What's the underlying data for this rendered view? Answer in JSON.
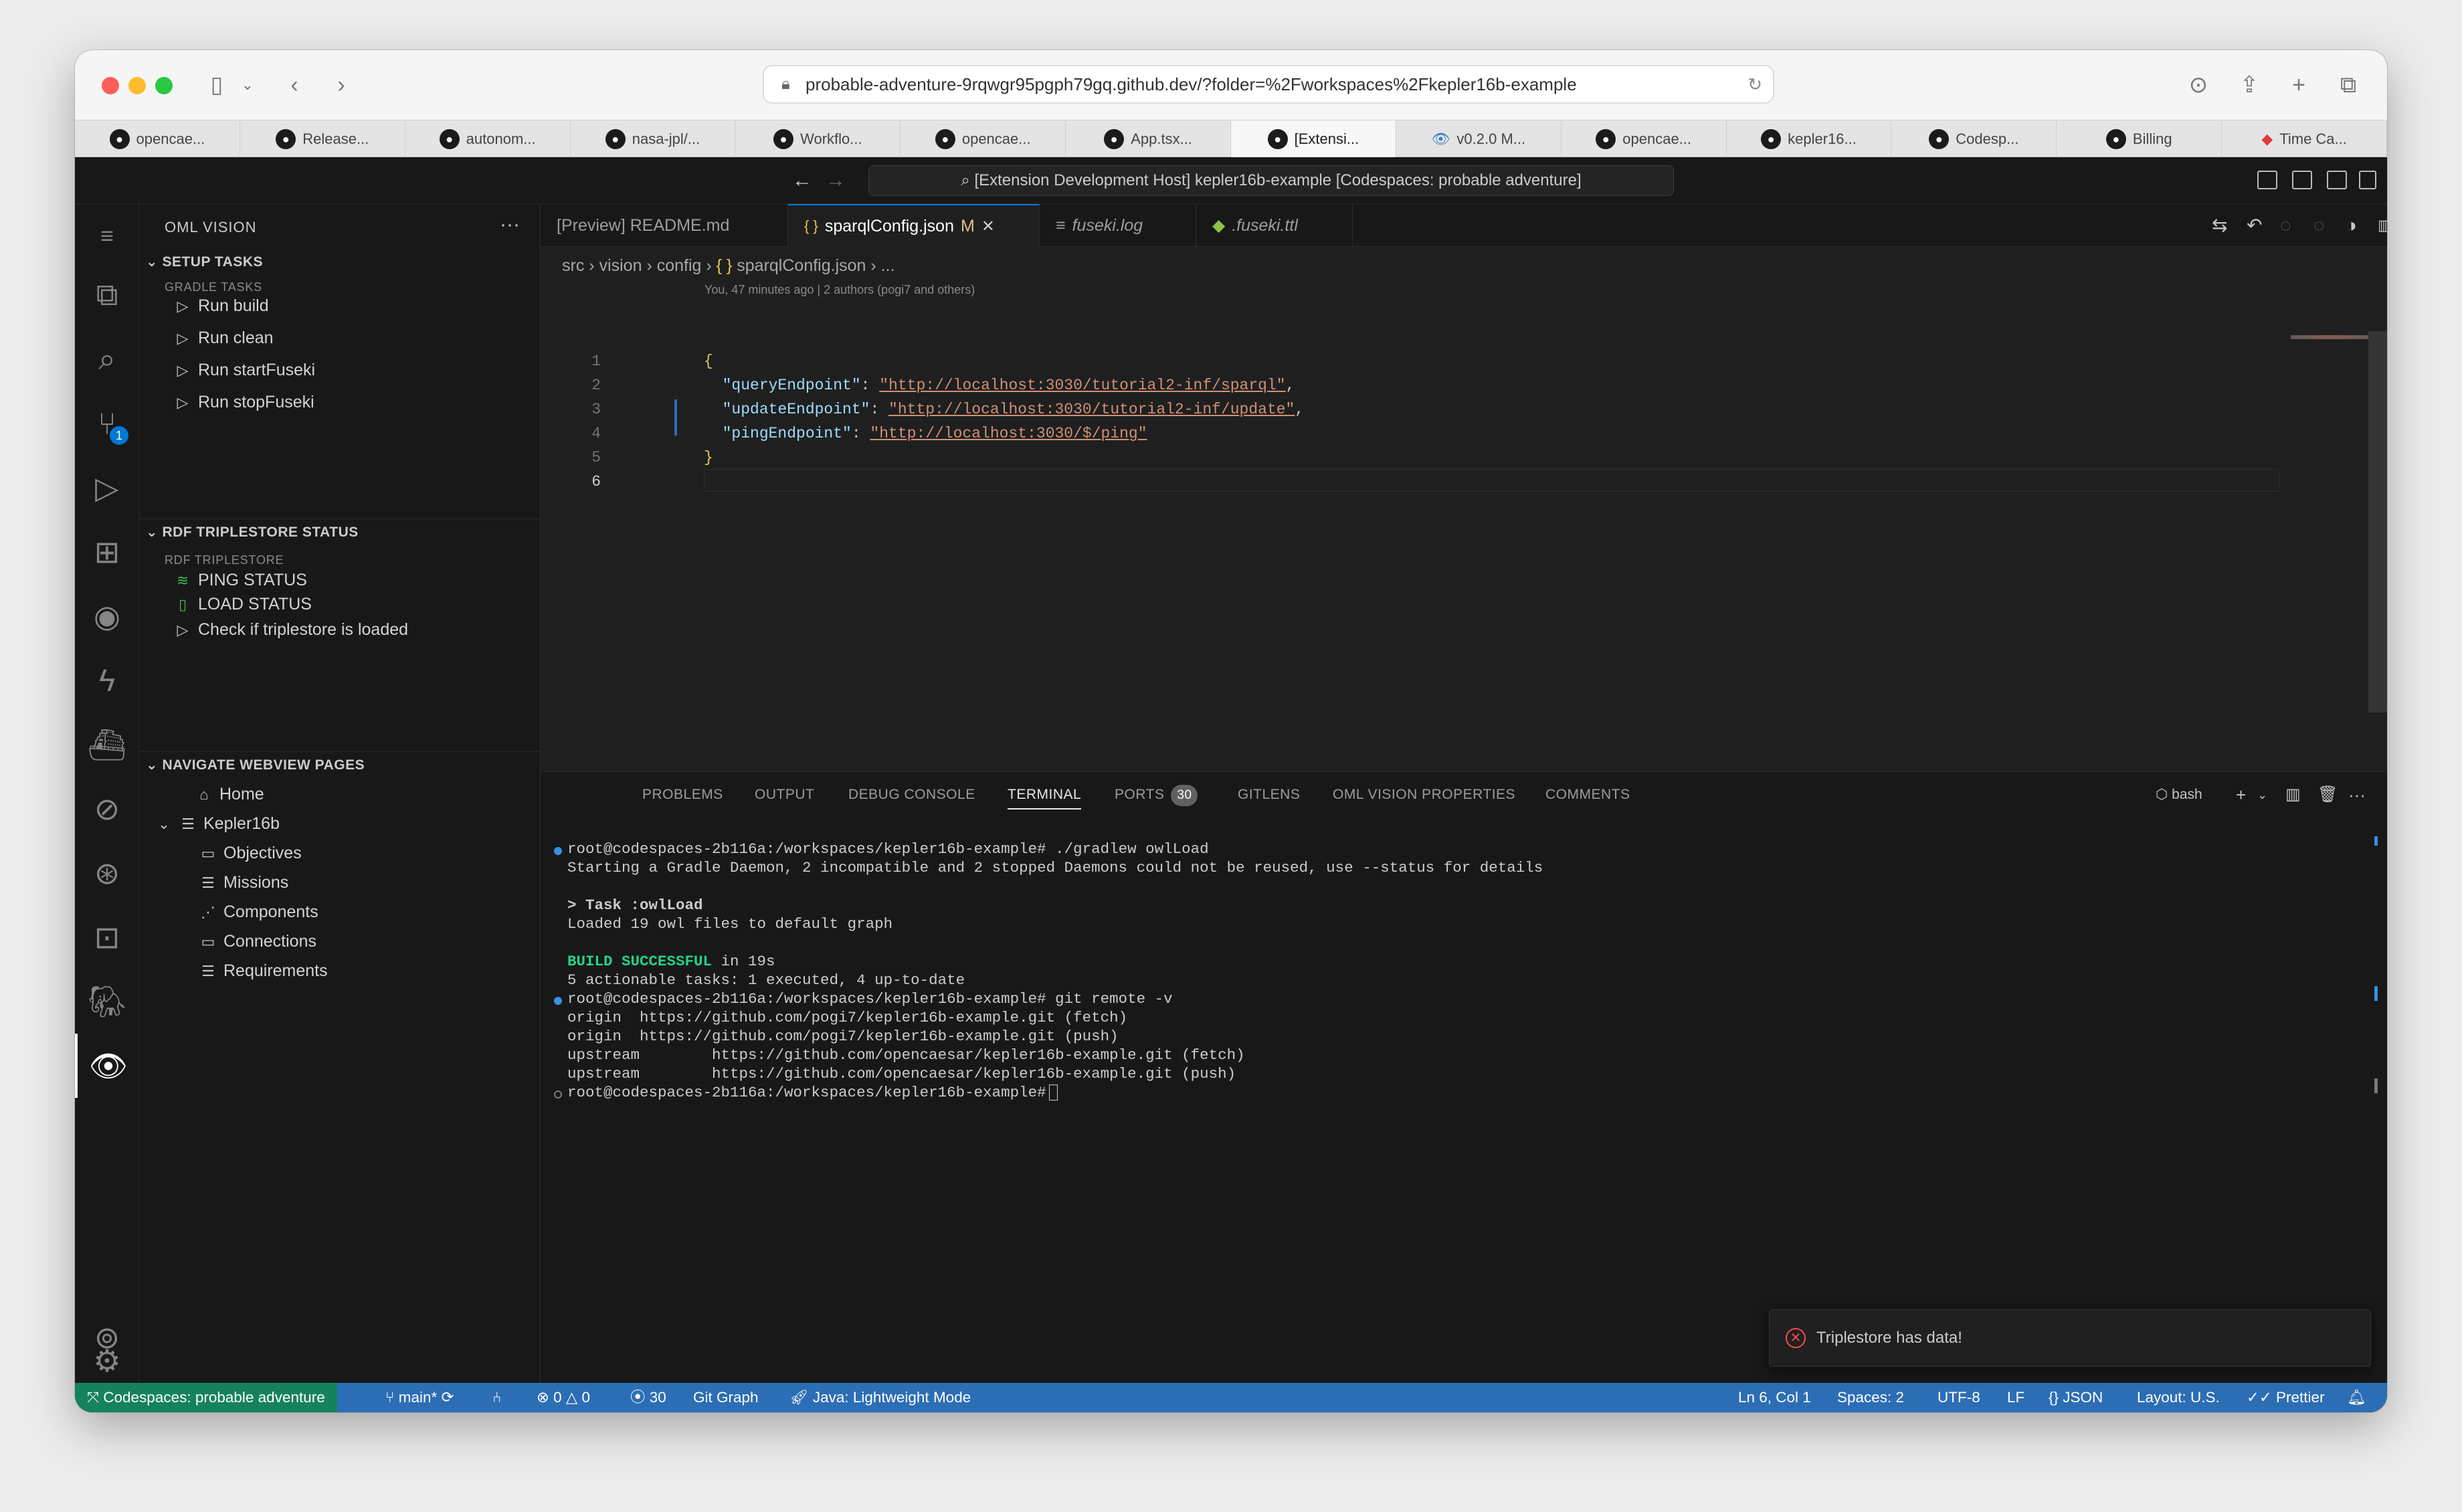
{
  "browser": {
    "url": "probable-adventure-9rqwgr95pgph79gq.github.dev/?folder=%2Fworkspaces%2Fkepler16b-example",
    "tabs": [
      {
        "label": "opencae...",
        "icon": "github-icon"
      },
      {
        "label": "Release...",
        "icon": "github-icon"
      },
      {
        "label": "autonom...",
        "icon": "github-icon"
      },
      {
        "label": "nasa-jpl/...",
        "icon": "github-icon"
      },
      {
        "label": "Workflo...",
        "icon": "github-icon"
      },
      {
        "label": "opencae...",
        "icon": "github-icon"
      },
      {
        "label": "App.tsx...",
        "icon": "github-icon"
      },
      {
        "label": "[Extensi...",
        "icon": "github-icon"
      },
      {
        "label": "v0.2.0 M...",
        "icon": "eye-icon"
      },
      {
        "label": "opencae...",
        "icon": "github-icon"
      },
      {
        "label": "kepler16...",
        "icon": "github-icon"
      },
      {
        "label": "Codesp...",
        "icon": "github-icon"
      },
      {
        "label": "Billing",
        "icon": "github-icon"
      },
      {
        "label": "Time Ca...",
        "icon": "diamond-icon"
      }
    ],
    "active_tab_index": 7
  },
  "vscode": {
    "command_center": "[Extension Development Host] kepler16b-example [Codespaces: probable adventure]"
  },
  "sidebar": {
    "title": "OML VISION",
    "setup": {
      "header": "SETUP TASKS",
      "subheader": "GRADLE TASKS",
      "items": [
        "Run build",
        "Run clean",
        "Run startFuseki",
        "Run stopFuseki"
      ]
    },
    "rdf": {
      "header": "RDF TRIPLESTORE STATUS",
      "subheader": "RDF TRIPLESTORE",
      "items": [
        "PING STATUS",
        "LOAD STATUS",
        "Check if triplestore is loaded"
      ]
    },
    "nav": {
      "header": "NAVIGATE WEBVIEW PAGES",
      "items": [
        "Home",
        "Kepler16b",
        "Objectives",
        "Missions",
        "Components",
        "Connections",
        "Requirements"
      ]
    }
  },
  "editor": {
    "tabs": [
      {
        "label": "[Preview] README.md"
      },
      {
        "label": "sparqlConfig.json",
        "modified": "M"
      },
      {
        "label": "fuseki.log"
      },
      {
        "label": ".fuseki.ttl"
      }
    ],
    "breadcrumb": [
      "src",
      "vision",
      "config",
      "sparqlConfig.json",
      "..."
    ],
    "blame": "You, 47 minutes ago | 2 authors (pogi7 and others)",
    "line_numbers": [
      "1",
      "2",
      "3",
      "4",
      "5",
      "6"
    ],
    "code": {
      "open_brace": "{",
      "close_brace": "}",
      "lines": [
        {
          "key": "\"queryEndpoint\"",
          "value": "\"http://localhost:3030/tutorial2-inf/sparql\"",
          "trail": ","
        },
        {
          "key": "\"updateEndpoint\"",
          "value": "\"http://localhost:3030/tutorial2-inf/update\"",
          "trail": ","
        },
        {
          "key": "\"pingEndpoint\"",
          "value": "\"http://localhost:3030/$/ping\"",
          "trail": ""
        }
      ]
    }
  },
  "panel": {
    "tabs": [
      "PROBLEMS",
      "OUTPUT",
      "DEBUG CONSOLE",
      "TERMINAL",
      "PORTS",
      "GITLENS",
      "OML VISION PROPERTIES",
      "COMMENTS"
    ],
    "active_tab": "TERMINAL",
    "ports_count": "30",
    "shell": "bash",
    "terminal": {
      "l1": "root@codespaces-2b116a:/workspaces/kepler16b-example# ./gradlew owlLoad",
      "l2": "Starting a Gradle Daemon, 2 incompatible and 2 stopped Daemons could not be reused, use --status for details",
      "l3": "> Task :owlLoad",
      "l4": "Loaded 19 owl files to default graph",
      "l5a": "BUILD SUCCESSFUL",
      "l5b": " in 19s",
      "l6": "5 actionable tasks: 1 executed, 4 up-to-date",
      "l7": "root@codespaces-2b116a:/workspaces/kepler16b-example# git remote -v",
      "l8": "origin  https://github.com/pogi7/kepler16b-example.git (fetch)",
      "l9": "origin  https://github.com/pogi7/kepler16b-example.git (push)",
      "l10": "upstream        https://github.com/opencaesar/kepler16b-example.git (fetch)",
      "l11": "upstream        https://github.com/opencaesar/kepler16b-example.git (push)",
      "l12": "root@codespaces-2b116a:/workspaces/kepler16b-example#"
    }
  },
  "notification": {
    "text": "Triplestore has data!",
    "icon": "error-circle-icon"
  },
  "statusbar": {
    "remote": "Codespaces: probable adventure",
    "branch": "main*",
    "errors": "0",
    "warnings": "0",
    "ports": "30",
    "git_graph": "Git Graph",
    "java": "Java: Lightweight Mode",
    "position": "Ln 6, Col 1",
    "spaces": "Spaces: 2",
    "encoding": "UTF-8",
    "eol": "LF",
    "language": "JSON",
    "layout": "Layout: U.S.",
    "prettier": "Prettier"
  },
  "colors": {
    "statusbar": "#2c6eb5",
    "remote": "#16825d",
    "accent": "#0078d4",
    "json_key": "#9cdcfe",
    "json_string": "#ce9178",
    "build_success": "#23d18b",
    "error": "#f14c4c"
  }
}
